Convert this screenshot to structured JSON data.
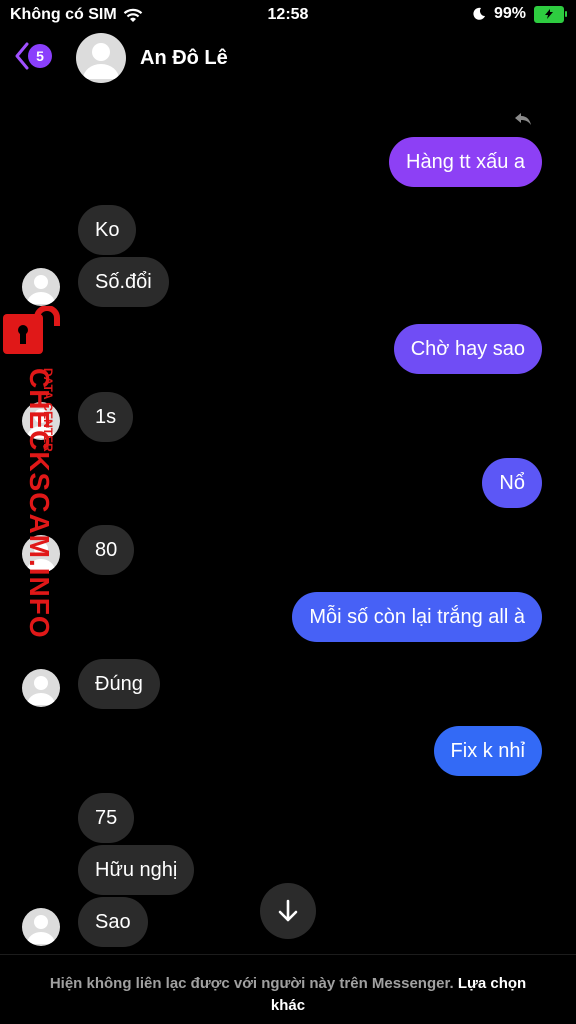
{
  "status": {
    "carrier": "Không có SIM",
    "time": "12:58",
    "battery": "99%"
  },
  "header": {
    "back_count": "5",
    "contact_name": "An Đô Lê"
  },
  "messages": [
    {
      "id": "m1",
      "from": "me",
      "text": "Hàng tt xấu a"
    },
    {
      "id": "m2",
      "from": "them",
      "text": "Ko"
    },
    {
      "id": "m3",
      "from": "them",
      "text": "Số.đổi"
    },
    {
      "id": "m4",
      "from": "me",
      "text": "Chờ hay sao"
    },
    {
      "id": "m5",
      "from": "them",
      "text": "1s"
    },
    {
      "id": "m6",
      "from": "me",
      "text": "Nổ"
    },
    {
      "id": "m7",
      "from": "them",
      "text": "80"
    },
    {
      "id": "m8",
      "from": "me",
      "text": "Mỗi số còn lại trắng all à"
    },
    {
      "id": "m9",
      "from": "them",
      "text": "Đúng"
    },
    {
      "id": "m10",
      "from": "me",
      "text": "Fix k nhỉ"
    },
    {
      "id": "m11",
      "from": "them",
      "text": "75"
    },
    {
      "id": "m12",
      "from": "them",
      "text": "Hữu nghị"
    },
    {
      "id": "m13",
      "from": "them",
      "text": "Sao"
    }
  ],
  "watermark": {
    "main": "CHECKSCAM.INFO",
    "sub": "DATA CENTER"
  },
  "footer": {
    "notice": "Hiện không liên lạc được với người này trên Messenger.",
    "action": "Lựa chọn khác"
  },
  "colors": {
    "sent_top": "#8e3ff5",
    "sent_bottom": "#2f6cf6",
    "received": "#2b2b2b",
    "accent": "#8a3ffc",
    "watermark": "#e01818"
  }
}
